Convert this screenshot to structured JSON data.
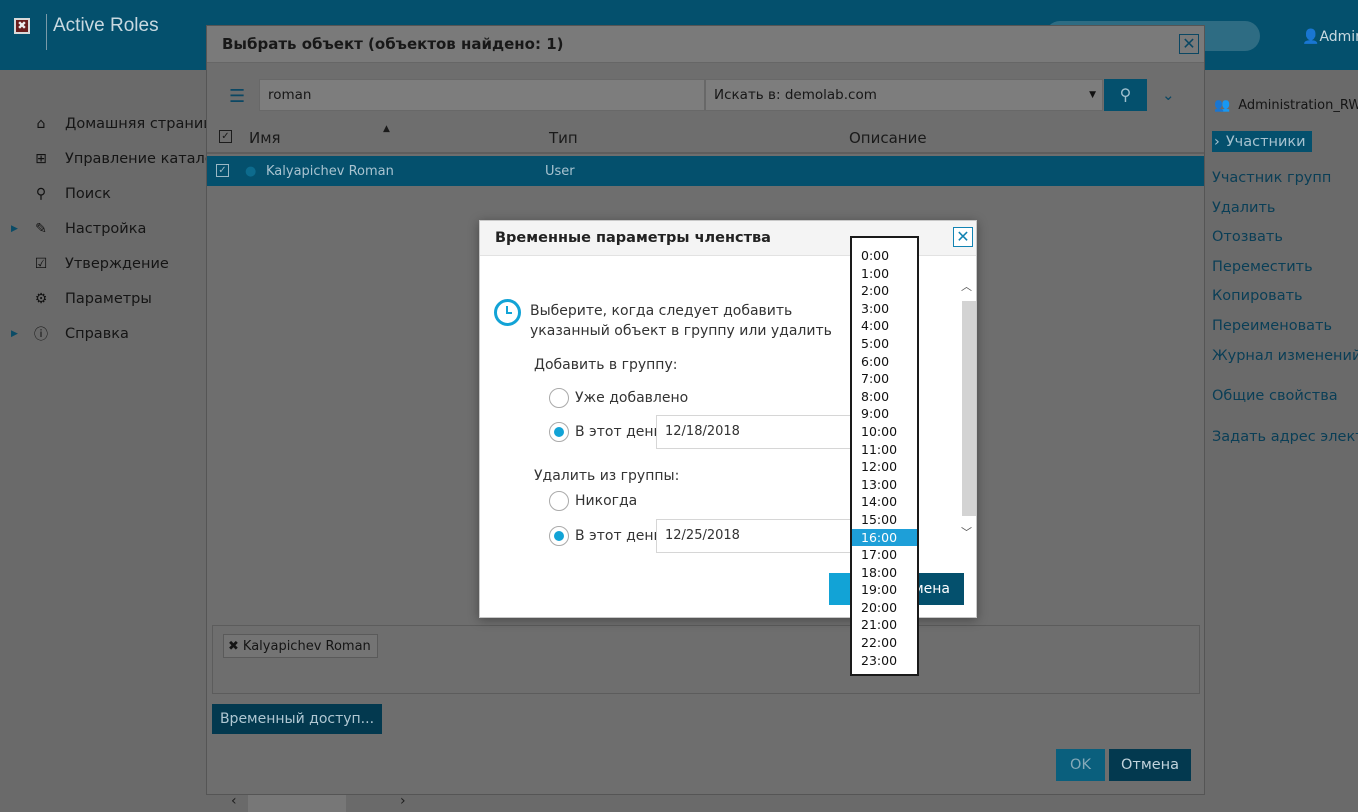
{
  "app": {
    "logo_glyph": "✖",
    "title": "Active Roles",
    "user": "Admini"
  },
  "nav": {
    "items": [
      {
        "label": "Домашняя страница",
        "icon": "home-icon",
        "glyph": "⌂",
        "arrow": ""
      },
      {
        "label": "Управление каталогом",
        "icon": "sitemap-icon",
        "glyph": "⊞",
        "arrow": ""
      },
      {
        "label": "Поиск",
        "icon": "search-icon",
        "glyph": "⚲",
        "arrow": ""
      },
      {
        "label": "Настройка",
        "icon": "wrench-icon",
        "glyph": "✎",
        "arrow": "▶"
      },
      {
        "label": "Утверждение",
        "icon": "checkbox-icon",
        "glyph": "☑",
        "arrow": ""
      },
      {
        "label": "Параметры",
        "icon": "gear-icon",
        "glyph": "⚙",
        "arrow": ""
      },
      {
        "label": "Справка",
        "icon": "info-icon",
        "glyph": "ⓘ",
        "arrow": "▶"
      }
    ]
  },
  "right_panel": {
    "title": "Administration_RW",
    "active": "Участники",
    "links": [
      "Участник групп",
      "Удалить",
      "Отозвать",
      "Переместить",
      "Копировать",
      "Переименовать",
      "Журнал изменений",
      "Общие свойства",
      "Задать адрес электро"
    ]
  },
  "select_dialog": {
    "title": "Выбрать объект  (объектов найдено: 1)",
    "close_glyph": "✕",
    "search_value": "roman",
    "scope_label": "Искать в:  demolab.com",
    "columns": {
      "name": "Имя",
      "type": "Тип",
      "description": "Описание"
    },
    "rows": [
      {
        "name": "Kalyapichev Roman",
        "type": "User",
        "description": ""
      }
    ],
    "selected_chip": "Kalyapichev Roman",
    "temp_access_button": "Временный доступ...",
    "ok_button": "OK",
    "cancel_button": "Отмена"
  },
  "temporal_modal": {
    "title": "Временные параметры членства",
    "close_glyph": "✕",
    "instruction": "Выберите, когда следует добавить указанный объект в группу или удалить его из группы.",
    "add_section": "Добавить в группу:",
    "already_added": "Уже добавлено",
    "on_this_day": "В этот день:",
    "add_date": "12/18/2018",
    "remove_section": "Удалить из группы:",
    "never": "Никогда",
    "remove_date": "12/25/2018",
    "ok_partial": "О",
    "cancel_partial": "мена"
  },
  "time_dropdown": {
    "options": [
      "0:00",
      "1:00",
      "2:00",
      "3:00",
      "4:00",
      "5:00",
      "6:00",
      "7:00",
      "8:00",
      "9:00",
      "10:00",
      "11:00",
      "12:00",
      "13:00",
      "14:00",
      "15:00",
      "16:00",
      "17:00",
      "18:00",
      "19:00",
      "20:00",
      "21:00",
      "22:00",
      "23:00"
    ],
    "selected": "16:00"
  },
  "colors": {
    "accent": "#12a3d6",
    "header_dark": "#04506d"
  }
}
